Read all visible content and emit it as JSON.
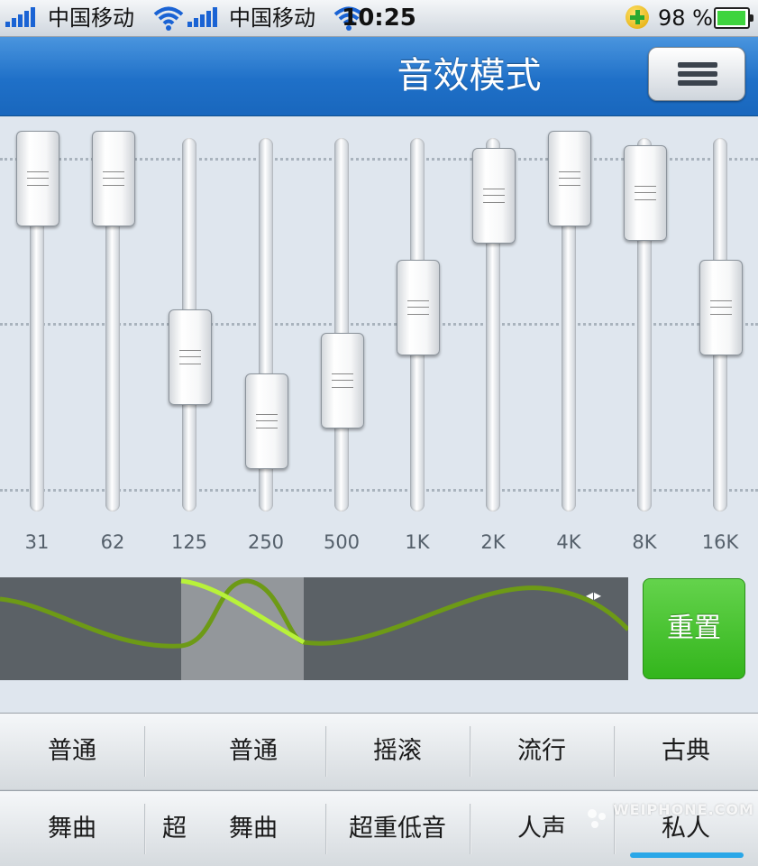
{
  "status_bar": {
    "left_carrier": "中国移动",
    "right_carrier": "中国移动",
    "time": "10:25",
    "battery": "98 %",
    "battery_level": 0.98
  },
  "nav": {
    "title": "音效模式",
    "menu_icon": "list-icon"
  },
  "equalizer": {
    "bands": [
      {
        "label": "31",
        "level": 1.0
      },
      {
        "label": "62",
        "level": 1.0
      },
      {
        "label": "125",
        "level": 0.39
      },
      {
        "label": "250",
        "level": 0.17
      },
      {
        "label": "500",
        "level": 0.31
      },
      {
        "label": "1K",
        "level": 0.56
      },
      {
        "label": "2K",
        "level": 0.94
      },
      {
        "label": "4K",
        "level": 1.0
      },
      {
        "label": "8K",
        "level": 0.95
      },
      {
        "label": "16K",
        "level": 0.56
      }
    ]
  },
  "preview": {
    "arrows": "◂▸",
    "reset_label": "重置"
  },
  "presets": {
    "row1": [
      "普通",
      "普通",
      "摇滚",
      "流行",
      "古典"
    ],
    "row2": [
      "舞曲",
      "超",
      "舞曲",
      "超重低音",
      "人声",
      "私人"
    ],
    "active": "私人"
  },
  "watermark": "WEIPHONE.COM"
}
